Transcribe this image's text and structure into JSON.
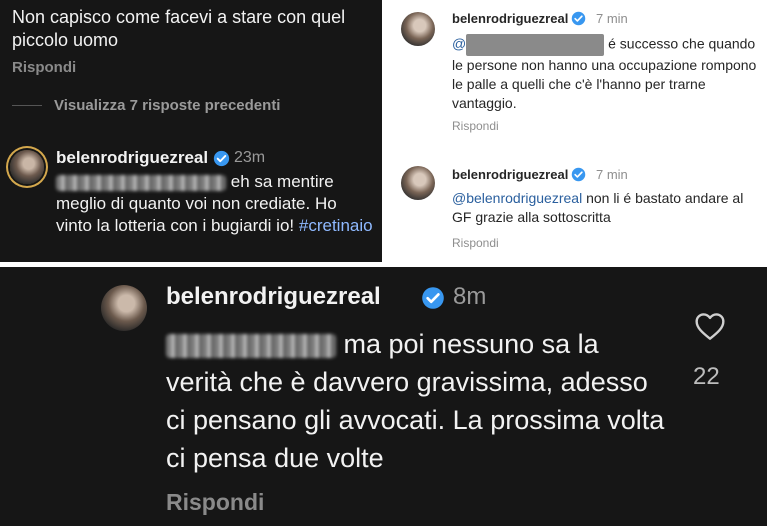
{
  "panel1": {
    "parent_comment": "Non capisco come facevi a stare con quel piccolo uomo",
    "reply_label": "Rispondi",
    "view_replies": "Visualizza 7 risposte precedenti",
    "username": "belenrodriguezreal",
    "time": "23m",
    "message": "eh sa mentire meglio di quanto voi non crediate. Ho vinto la lotteria con i bugiardi io!",
    "hashtag": "#cretinaio"
  },
  "panel2": {
    "comments": [
      {
        "username": "belenrodriguezreal",
        "time": "7 min",
        "mention_prefix": "@",
        "message": "é successo che quando le persone non hanno una occupazione rompono le palle a quelli che c'è l'hanno per trarne vantaggio.",
        "reply_label": "Rispondi"
      },
      {
        "username": "belenrodriguezreal",
        "time": "7 min",
        "mention": "@belenrodriguezreal",
        "message": "non li é bastato andare al GF grazie alla sottoscritta",
        "reply_label": "Rispondi"
      }
    ]
  },
  "panel3": {
    "username": "belenrodriguezreal",
    "time": "8m",
    "message": "ma poi nessuno sa la verità che è davvero gravissima, adesso ci pensano gli avvocati. La prossima volta ci pensa due volte",
    "reply_label": "Rispondi",
    "like_count": "22",
    "heart_icon": "heart-outline-icon"
  },
  "colors": {
    "dark_bg": "#161616",
    "verified_blue": "#3897f0",
    "hashtag": "#8fb9ff",
    "mention": "#2a5f9e"
  }
}
